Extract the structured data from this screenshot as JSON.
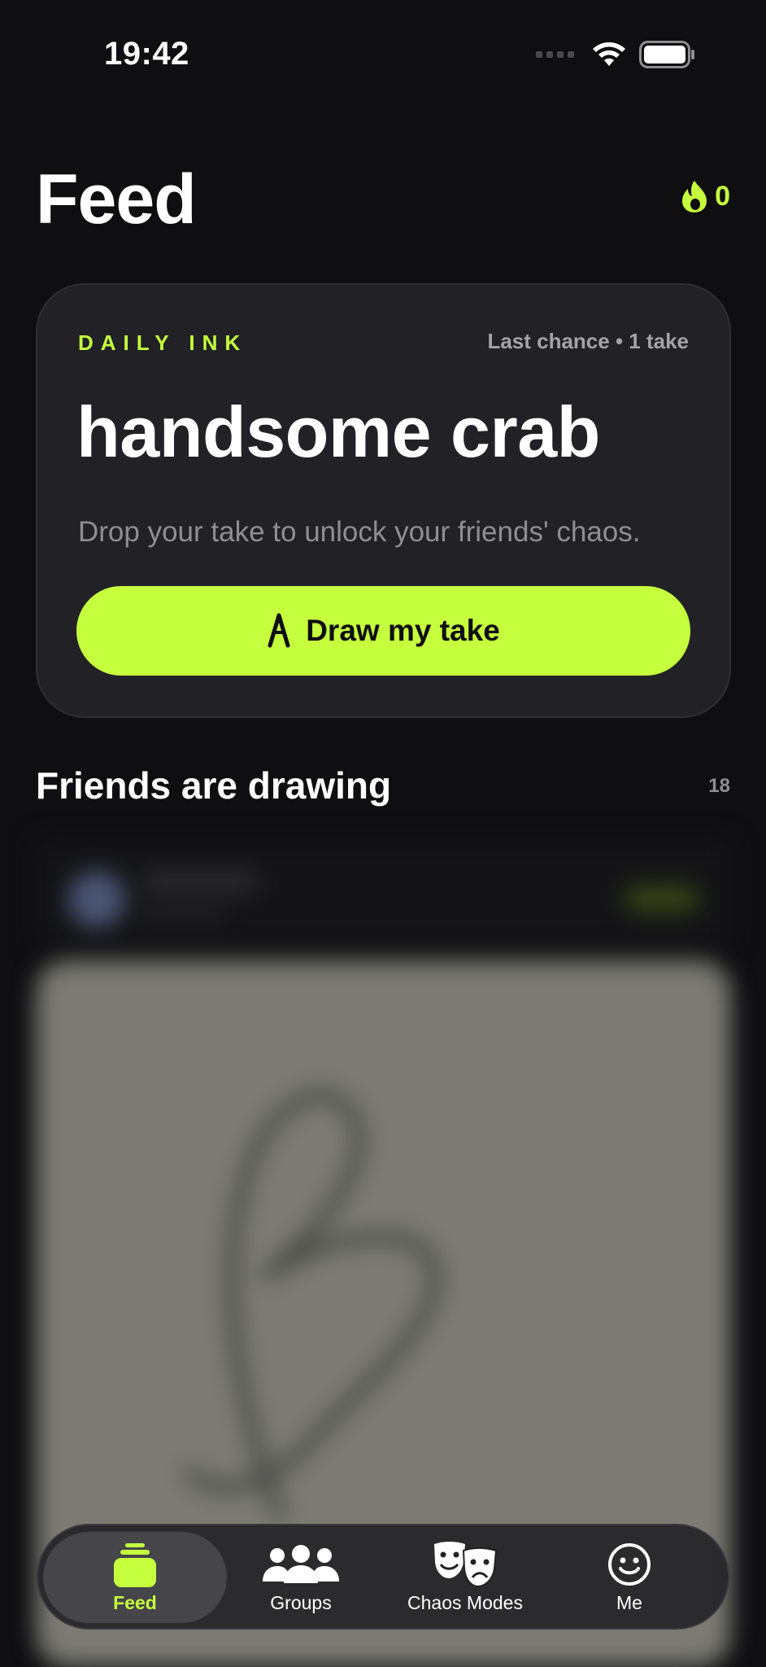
{
  "status": {
    "time": "19:42"
  },
  "header": {
    "title": "Feed",
    "streak_count": "0"
  },
  "daily": {
    "label": "DAILY INK",
    "meta": "Last chance • 1 take",
    "prompt": "handsome crab",
    "subtitle": "Drop your take to unlock your friends' chaos.",
    "button_label": "Draw my take"
  },
  "friends": {
    "title": "Friends are drawing",
    "count": "18"
  },
  "tabs": [
    {
      "label": "Feed",
      "icon": "stack-icon",
      "active": true
    },
    {
      "label": "Groups",
      "icon": "people-icon",
      "active": false
    },
    {
      "label": "Chaos Modes",
      "icon": "theater-masks-icon",
      "active": false
    },
    {
      "label": "Me",
      "icon": "smiley-icon",
      "active": false
    }
  ],
  "colors": {
    "accent": "#c5ff3d",
    "background": "#0f0f11",
    "card": "#222226"
  }
}
